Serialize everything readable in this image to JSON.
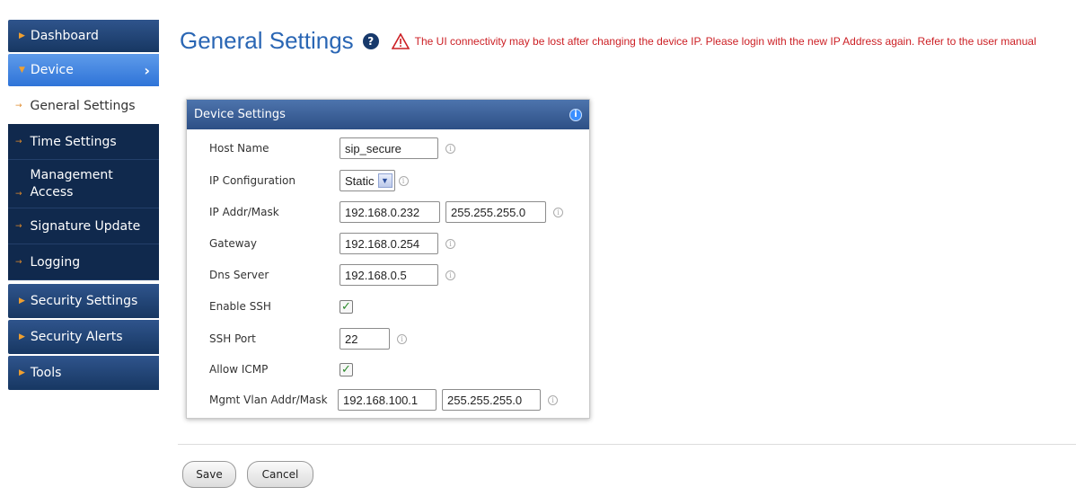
{
  "sidebar": {
    "dashboard": "Dashboard",
    "device": "Device",
    "sub_items": [
      "General Settings",
      "Time Settings",
      "Management Access",
      "Signature Update",
      "Logging"
    ],
    "lower_items": [
      "Security Settings",
      "Security Alerts",
      "Tools"
    ]
  },
  "header": {
    "title": "General Settings",
    "help_icon": "?",
    "warning": "The UI connectivity may be lost after changing the device IP. Please login with the new IP Address again. Refer to the user manual"
  },
  "panel": {
    "title": "Device Settings",
    "info_icon": "i",
    "fields": {
      "host_name": {
        "label": "Host Name",
        "value": "sip_secure"
      },
      "ip_config": {
        "label": "IP Configuration",
        "value": "Static"
      },
      "ip_addr_mask": {
        "label": "IP Addr/Mask",
        "addr": "192.168.0.232",
        "mask": "255.255.255.0"
      },
      "gateway": {
        "label": "Gateway",
        "value": "192.168.0.254"
      },
      "dns_server": {
        "label": "Dns Server",
        "value": "192.168.0.5"
      },
      "enable_ssh": {
        "label": "Enable SSH",
        "checked": true
      },
      "ssh_port": {
        "label": "SSH Port",
        "value": "22"
      },
      "allow_icmp": {
        "label": "Allow ICMP",
        "checked": true
      },
      "mgmt_vlan": {
        "label": "Mgmt Vlan Addr/Mask",
        "addr": "192.168.100.1",
        "mask": "255.255.255.0"
      }
    }
  },
  "footer": {
    "save": "Save",
    "cancel": "Cancel"
  },
  "colors": {
    "nav_dark": "#173762",
    "nav_active": "#2f74d8",
    "title_blue": "#2a66b4",
    "warning_red": "#cc1f24"
  }
}
